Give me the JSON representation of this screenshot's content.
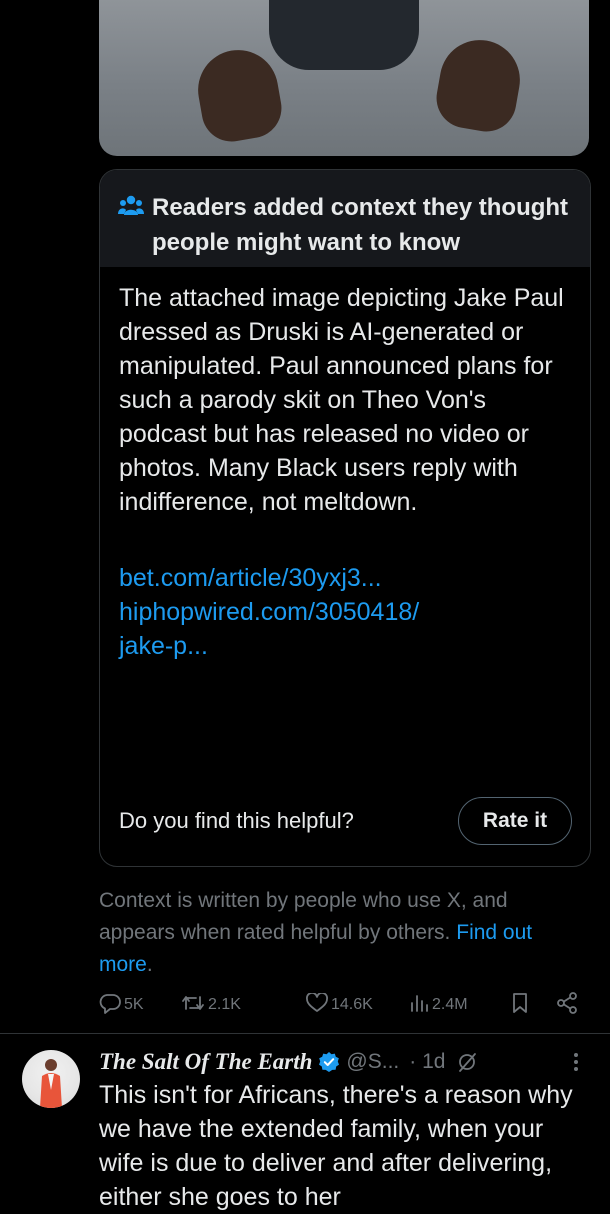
{
  "community_note": {
    "header_icon": "people-icon",
    "title": "Readers added context they thought people might want to know",
    "body": "The attached image depicting Jake Paul dressed as Druski is AI-generated or manipulated. Paul announced plans for such a parody skit on Theo Von's podcast but has released no video or photos. Many Black users reply with indifference, not meltdown.",
    "links": [
      "bet.com/article/30yxj3...",
      "hiphopwired.com/3050418/\njake-p..."
    ],
    "helpful_question": "Do you find this helpful?",
    "rate_button": "Rate it"
  },
  "context_footer": {
    "text": "Context is written by people who use X, and appears when rated helpful by others.",
    "link": "Find out more",
    "period": "."
  },
  "actions": {
    "replies": "5K",
    "reposts": "2.1K",
    "likes": "14.6K",
    "views": "2.4M",
    "icons": [
      "reply-icon",
      "repost-icon",
      "heart-icon",
      "views-icon",
      "bookmark-icon",
      "share-icon"
    ]
  },
  "reply": {
    "name": "The Salt Of The Earth",
    "handle": "@S...",
    "time": "· 1d",
    "text": "This isn't for Africans, there's a reason why we have the extended family, when your wife is due to deliver and after delivering, either she goes to her"
  },
  "colors": {
    "background": "#000000",
    "text": "#e7e9ea",
    "muted": "#71767b",
    "link": "#1d9bf0",
    "border": "#2f3336",
    "verified": "#1d9bf0"
  }
}
